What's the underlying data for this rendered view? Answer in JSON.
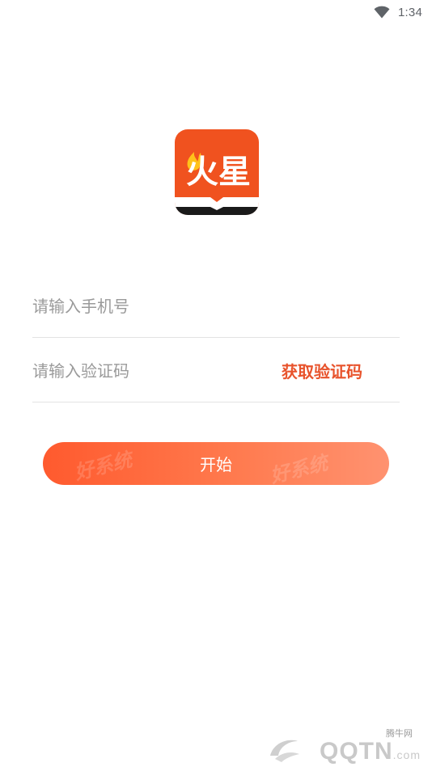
{
  "status_bar": {
    "time": "1:34"
  },
  "logo": {
    "text": "火星"
  },
  "form": {
    "phone_placeholder": "请输入手机号",
    "code_placeholder": "请输入验证码",
    "get_code_label": "获取验证码",
    "start_label": "开始"
  },
  "watermark": {
    "small_text": "腾牛网",
    "brand": "QQTN",
    "domain": ".com"
  },
  "colors": {
    "accent": "#e8532c",
    "button_start": "#ff5a2e",
    "button_end": "#ff9270"
  }
}
